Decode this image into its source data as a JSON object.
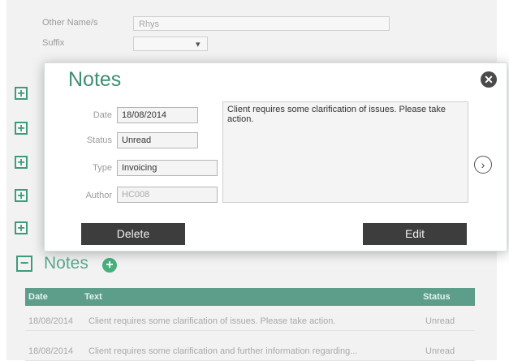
{
  "background": {
    "form": {
      "other_names_label": "Other Name/s",
      "other_names_value": "Rhys",
      "suffix_label": "Suffix",
      "suffix_arrow": "▾"
    },
    "notes_section": {
      "title": "Notes",
      "add_symbol": "+",
      "table": {
        "columns": [
          "Date",
          "Text",
          "Status"
        ],
        "rows": [
          {
            "date": "18/08/2014",
            "text": "Client requires some clarification of issues. Please take action.",
            "status": "Unread"
          },
          {
            "date": "18/08/2014",
            "text": "Client requires some clarification and further information regarding...",
            "status": "Unread"
          }
        ]
      }
    }
  },
  "modal": {
    "title": "Notes",
    "close_symbol": "✕",
    "next_symbol": "›",
    "fields": {
      "date_label": "Date",
      "date_value": "18/08/2014",
      "status_label": "Status",
      "status_value": "Unread",
      "type_label": "Type",
      "type_value": "Invoicing",
      "author_label": "Author",
      "author_value": "HC008"
    },
    "note_text": "Client requires some clarification of issues. Please take action.",
    "delete_label": "Delete",
    "edit_label": "Edit"
  },
  "icons": {
    "expand": "+",
    "collapse": "−"
  }
}
